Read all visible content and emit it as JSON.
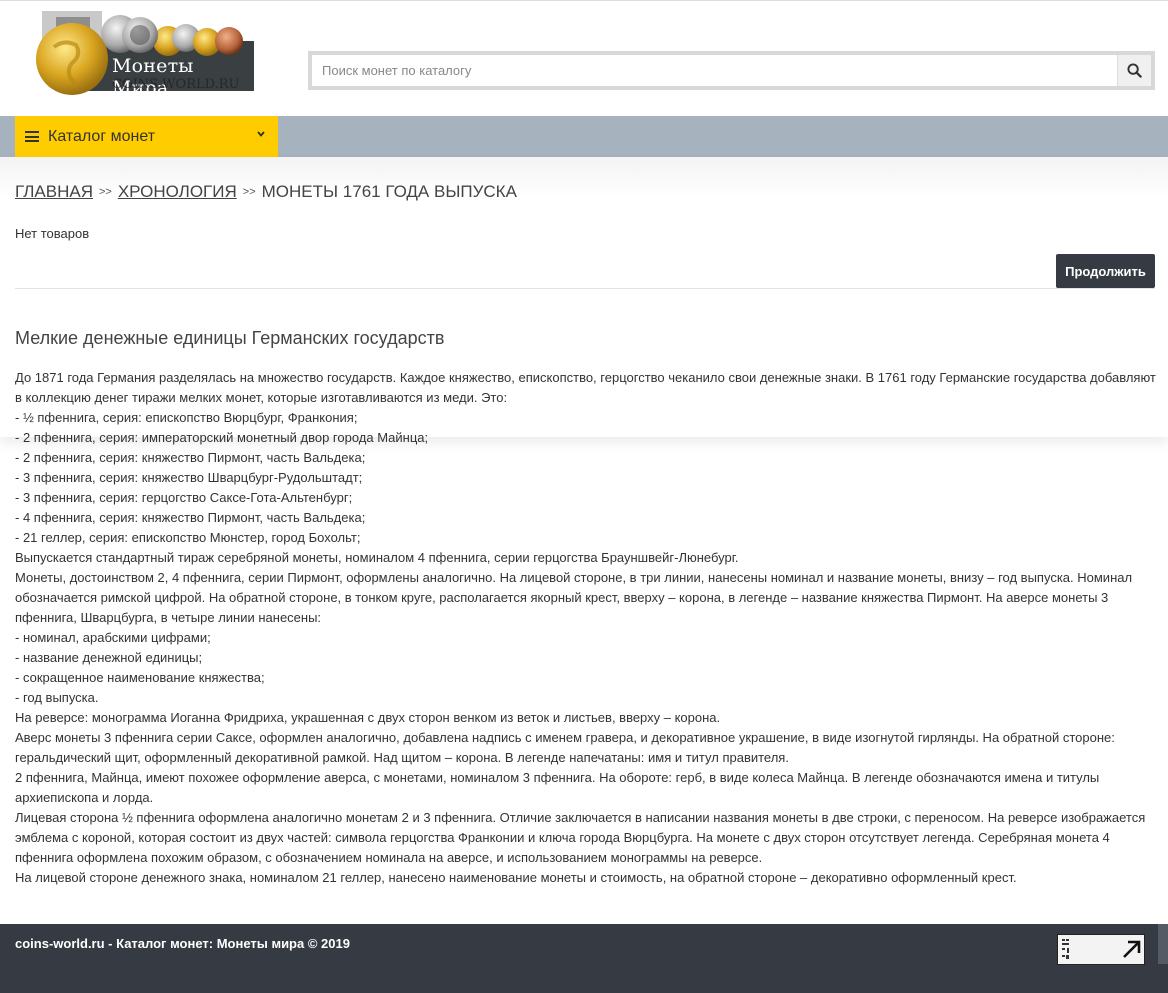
{
  "header": {
    "logo_title": "Монеты Мира",
    "logo_subtitle": "COINS-WORLD.RU",
    "search_placeholder": "Поиск монет по каталогу"
  },
  "nav": {
    "catalog_label": "Каталог монет"
  },
  "breadcrumb": {
    "items": [
      "ГЛАВНАЯ",
      "ХРОНОЛОГИЯ"
    ],
    "separator": ">>",
    "current": "МОНЕТЫ 1761 ГОДА ВЫПУСКА"
  },
  "content": {
    "no_items": "Нет товаров",
    "continue_label": "Продолжить",
    "article_title": "Мелкие денежные единицы Германских государств",
    "paragraphs": [
      "До 1871 года Германия разделялась на множество государств. Каждое княжество, епископство, герцогство чеканило свои денежные знаки. В 1761 году Германские государства добавляют в коллекцию денег тиражи мелких монет, которые изготавливаются из меди. Это:",
      "- ½ пфеннига, серия: епископство Вюрцбург, Франкония;",
      "- 2 пфеннига, серия: императорский монетный двор города Майнца;",
      "- 2 пфеннига, серия: княжество Пирмонт, часть Вальдека;",
      "- 3 пфеннига, серия: княжество Шварцбург-Рудольштадт;",
      "- 3 пфеннига, серия: герцогство Саксе-Гота-Альтенбург;",
      "- 4 пфеннига, серия: княжество Пирмонт, часть Вальдека;",
      "- 21 геллер, серия: епископство Мюнстер, город Бохольт;",
      "Выпускается стандартный тираж серебряной монеты, номиналом 4 пфеннига, серии герцогства Брауншвейг-Люнебург.",
      "Монеты, достоинством 2, 4 пфеннига, серии Пирмонт, оформлены аналогично. На лицевой стороне, в три линии, нанесены номинал и название монеты, внизу – год выпуска. Номинал обозначается римской цифрой. На обратной стороне, в тонком круге, располагается якорный крест, вверху – корона, в легенде – название княжества Пирмонт. На аверсе монеты 3 пфеннига, Шварцбурга, в четыре линии нанесены:",
      "- номинал, арабскими цифрами;",
      "- название денежной единицы;",
      "- сокращенное наименование княжества;",
      "- год выпуска.",
      "На реверсе: монограмма Иоганна Фридриха, украшенная с двух сторон венком из веток и листьев, вверху – корона.",
      "Аверс монеты 3 пфеннига серии Саксе, оформлен аналогично, добавлена надпись с именем гравера, и декоративное украшение, в виде изогнутой гирлянды. На обратной стороне: геральдический щит, оформленный декоративной рамкой. Над щитом – корона. В легенде напечатаны: имя и титул правителя.",
      "2 пфеннига, Майнца, имеют похожее оформление аверса, с монетами, номиналом 3 пфеннига. На обороте: герб, в виде колеса Майнца. В легенде обозначаются имена и титулы архиепископа и лорда.",
      "Лицевая сторона ½ пфеннига оформлена аналогично монетам 2 и 3 пфеннига. Отличие заключается в написании названия монеты в две строки, с переносом. На реверсе изображается эмблема с короной, которая состоит из двух частей: символа герцогства Франконии и ключа города Вюрцбурга. На монете с двух сторон отсутствует легенда. Серебряная монета 4 пфеннига оформлена похожим образом, с обозначением номинала на аверсе, и использованием монограммы на реверсе.",
      "На лицевой стороне денежного знака, номиналом 21 геллер, нанесено наименование монеты и стоимость, на обратной стороне – декоративно оформленный крест."
    ]
  },
  "footer": {
    "text": "coins-world.ru - Каталог монет: Монеты мира © 2019"
  },
  "colors": {
    "accent": "#ffcc00",
    "navbar": "#a7b2bf",
    "dark": "#353a43"
  }
}
